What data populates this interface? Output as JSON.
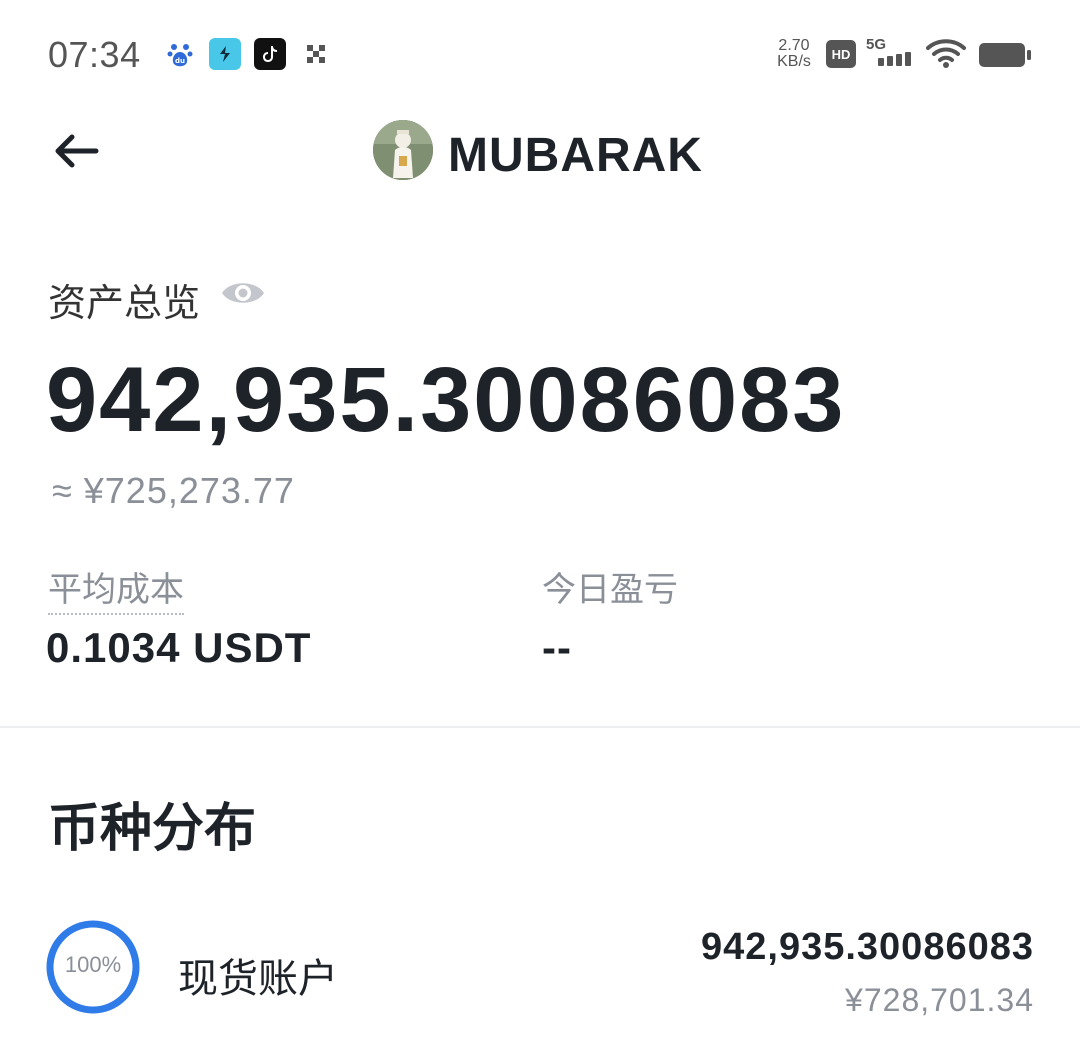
{
  "status_bar": {
    "time": "07:34",
    "speed_value": "2.70",
    "speed_unit": "KB/s",
    "hd_badge": "HD",
    "network": "5G",
    "icons": [
      "baidu-icon",
      "relay-app-icon",
      "tiktok-icon",
      "x-app-icon",
      "signal-icon",
      "wifi-icon",
      "battery-icon"
    ]
  },
  "header": {
    "coin_name": "MUBARAK",
    "back_icon": "arrow-left-icon"
  },
  "overview": {
    "label": "资产总览",
    "eye_icon": "eye-icon",
    "amount": "942,935.30086083",
    "fiat": "≈ ¥725,273.77",
    "avg_cost_label": "平均成本",
    "avg_cost_value": "0.1034 USDT",
    "today_pnl_label": "今日盈亏",
    "today_pnl_value": "--"
  },
  "distribution": {
    "title": "币种分布",
    "accounts": [
      {
        "percent": "100%",
        "percent_value": 1.0,
        "name": "现货账户",
        "amount": "942,935.30086083",
        "fiat": "¥728,701.34"
      }
    ]
  },
  "colors": {
    "ring": "#2f7be8",
    "text_primary": "#1e2329",
    "text_secondary": "#8a8f98"
  }
}
